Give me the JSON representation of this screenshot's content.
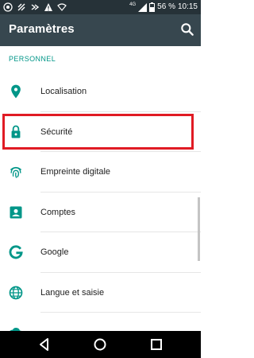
{
  "status_bar": {
    "network": "4G",
    "battery_percent": "56 %",
    "time": "10:15",
    "icons": [
      "wifi-location-icon",
      "notification-icon",
      "edge-icon",
      "alert-icon",
      "cast-icon",
      "cellular-icon",
      "battery-icon"
    ]
  },
  "app_bar": {
    "title": "Paramètres",
    "search_icon": "search-icon"
  },
  "section": {
    "header": "PERSONNEL"
  },
  "items": [
    {
      "label": "Localisation",
      "icon": "location-pin-icon"
    },
    {
      "label": "Sécurité",
      "icon": "lock-icon"
    },
    {
      "label": "Empreinte digitale",
      "icon": "fingerprint-icon"
    },
    {
      "label": "Comptes",
      "icon": "account-box-icon"
    },
    {
      "label": "Google",
      "icon": "google-icon"
    },
    {
      "label": "Langue et saisie",
      "icon": "globe-icon"
    },
    {
      "label": "",
      "icon": "backup-icon"
    }
  ],
  "highlighted_item": "Sécurité",
  "nav_bar": {
    "buttons": [
      "back-icon",
      "home-icon",
      "recents-icon"
    ]
  },
  "colors": {
    "status_bar": "#263238",
    "app_bar": "#37474f",
    "accent": "#009688",
    "highlight": "#e01b24"
  }
}
